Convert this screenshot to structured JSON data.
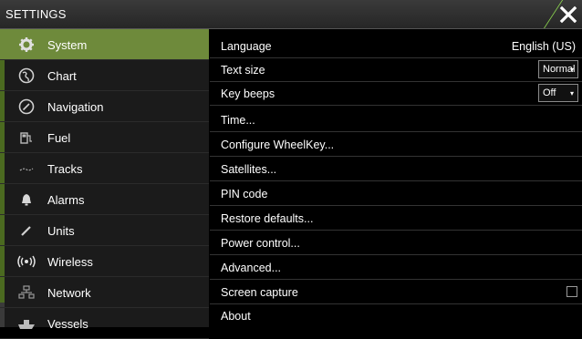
{
  "window": {
    "title": "SETTINGS"
  },
  "sidebar": {
    "items": [
      {
        "label": "System",
        "icon": "gear-icon",
        "selected": true
      },
      {
        "label": "Chart",
        "icon": "globe-icon"
      },
      {
        "label": "Navigation",
        "icon": "compass-icon"
      },
      {
        "label": "Fuel",
        "icon": "fuel-pump-icon"
      },
      {
        "label": "Tracks",
        "icon": "tracks-icon"
      },
      {
        "label": "Alarms",
        "icon": "bell-icon"
      },
      {
        "label": "Units",
        "icon": "pencil-icon"
      },
      {
        "label": "Wireless",
        "icon": "wireless-icon"
      },
      {
        "label": "Network",
        "icon": "network-icon"
      },
      {
        "label": "Vessels",
        "icon": "vessels-icon"
      }
    ]
  },
  "main": {
    "language": {
      "label": "Language",
      "value": "English (US)"
    },
    "text_size": {
      "label": "Text size",
      "value": "Normal"
    },
    "key_beeps": {
      "label": "Key beeps",
      "value": "Off"
    },
    "time": {
      "label": "Time..."
    },
    "configure_wheelkey": {
      "label": "Configure WheelKey..."
    },
    "satellites": {
      "label": "Satellites..."
    },
    "pin_code": {
      "label": "PIN code"
    },
    "restore_defaults": {
      "label": "Restore defaults..."
    },
    "power_control": {
      "label": "Power control..."
    },
    "advanced": {
      "label": "Advanced..."
    },
    "screen_capture": {
      "label": "Screen capture",
      "checked": false
    },
    "about": {
      "label": "About"
    }
  },
  "colors": {
    "accent": "#6e8a3b",
    "title_accent": "#8ad24e",
    "sidebar_bg": "#1b1b1b",
    "main_bg": "#000000"
  }
}
